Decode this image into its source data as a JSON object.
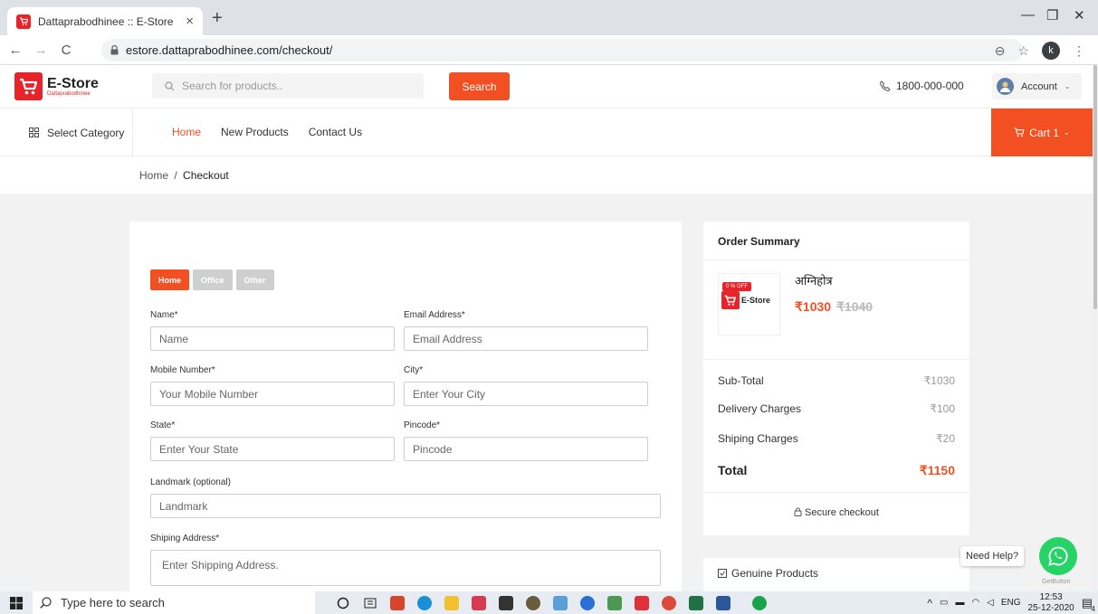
{
  "browser": {
    "tab_title": "Dattaprabodhinee :: E-Store",
    "url": "estore.dattaprabodhinee.com/checkout/",
    "profile_initial": "k"
  },
  "header": {
    "logo_title": "E-Store",
    "logo_subtitle": "Dattaprabodhinee",
    "search_placeholder": "Search for products..",
    "search_button": "Search",
    "phone": "1800-000-000",
    "account_label": "Account"
  },
  "nav": {
    "category_label": "Select Category",
    "links": [
      "Home",
      "New Products",
      "Contact Us"
    ],
    "cart_label": "Cart 1"
  },
  "breadcrumb": {
    "home": "Home",
    "separator": "/",
    "current": "Checkout"
  },
  "form": {
    "address_types": [
      "Home",
      "Office",
      "Other"
    ],
    "active_type": "Home",
    "fields": {
      "name": {
        "label": "Name*",
        "placeholder": "Name"
      },
      "email": {
        "label": "Email Address*",
        "placeholder": "Email Address"
      },
      "mobile": {
        "label": "Mobile Number*",
        "placeholder": "Your Mobile Number"
      },
      "city": {
        "label": "City*",
        "placeholder": "Enter Your City"
      },
      "state": {
        "label": "State*",
        "placeholder": "Enter Your State"
      },
      "pincode": {
        "label": "Pincode*",
        "placeholder": "Pincode"
      },
      "landmark": {
        "label": "Landmark (optional)",
        "placeholder": "Landmark"
      },
      "shipping": {
        "label": "Shiping Address*",
        "placeholder": "Enter Shipping Address."
      }
    }
  },
  "summary": {
    "title": "Order Summary",
    "product": {
      "name": "अग्निहोत्र",
      "discount_badge": "0 % OFF",
      "thumb_brand": "E-Store",
      "price": "₹1030",
      "old_price": "₹1040"
    },
    "rows": [
      {
        "label": "Sub-Total",
        "value": "₹1030"
      },
      {
        "label": "Delivery Charges",
        "value": "₹100"
      },
      {
        "label": "Shiping Charges",
        "value": "₹20"
      }
    ],
    "total_label": "Total",
    "total_value": "₹1150",
    "secure_label": "Secure checkout",
    "genuine_label": "Genuine Products"
  },
  "widgets": {
    "help_label": "Need Help?",
    "getbutton_label": "GetButton"
  },
  "taskbar": {
    "search_placeholder": "Type here to search",
    "language": "ENG",
    "time": "12:53",
    "date": "25-12-2020",
    "notification_count": "4"
  },
  "colors": {
    "accent": "#f25022",
    "logo_red": "#e8232a",
    "whatsapp": "#25d366"
  }
}
